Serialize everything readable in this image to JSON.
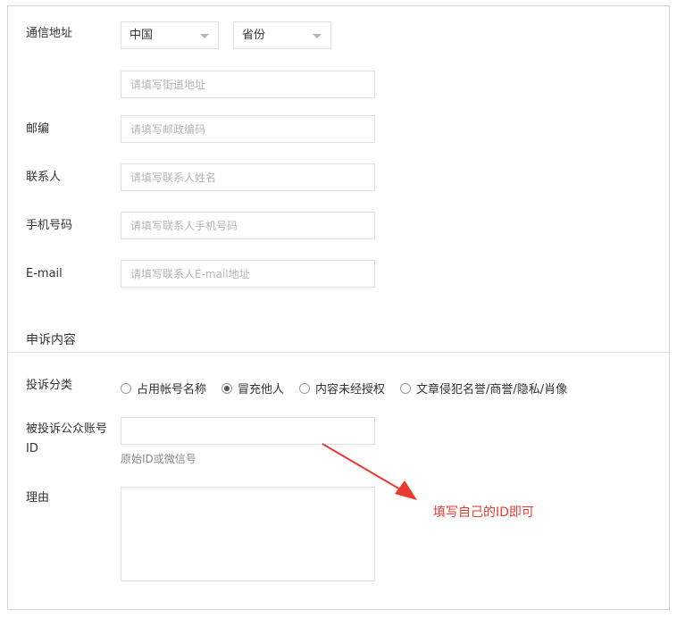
{
  "address": {
    "label": "通信地址",
    "country_select": "中国",
    "province_select": "省份",
    "street_placeholder": "请填写街道地址"
  },
  "postcode": {
    "label": "邮编",
    "placeholder": "请填写邮政编码"
  },
  "contact": {
    "label": "联系人",
    "placeholder": "请填写联系人姓名"
  },
  "phone": {
    "label": "手机号码",
    "placeholder": "请填写联系人手机号码"
  },
  "email": {
    "label": "E-mail",
    "placeholder": "请填写联系人E-mail地址"
  },
  "complaint": {
    "section_title": "申诉内容",
    "category_label": "投诉分类",
    "options": [
      {
        "label": "占用帐号名称",
        "checked": false
      },
      {
        "label": "冒充他人",
        "checked": true
      },
      {
        "label": "内容未经授权",
        "checked": false
      },
      {
        "label": "文章侵犯名誉/商誉/隐私/肖像",
        "checked": false
      }
    ],
    "account_label_line1": "被投诉公众账号",
    "account_label_line2": "ID",
    "account_hint": "原始ID或微信号",
    "reason_label": "理由"
  },
  "annotation": {
    "text": "填写自己的ID即可",
    "color": "#e83a2f"
  }
}
